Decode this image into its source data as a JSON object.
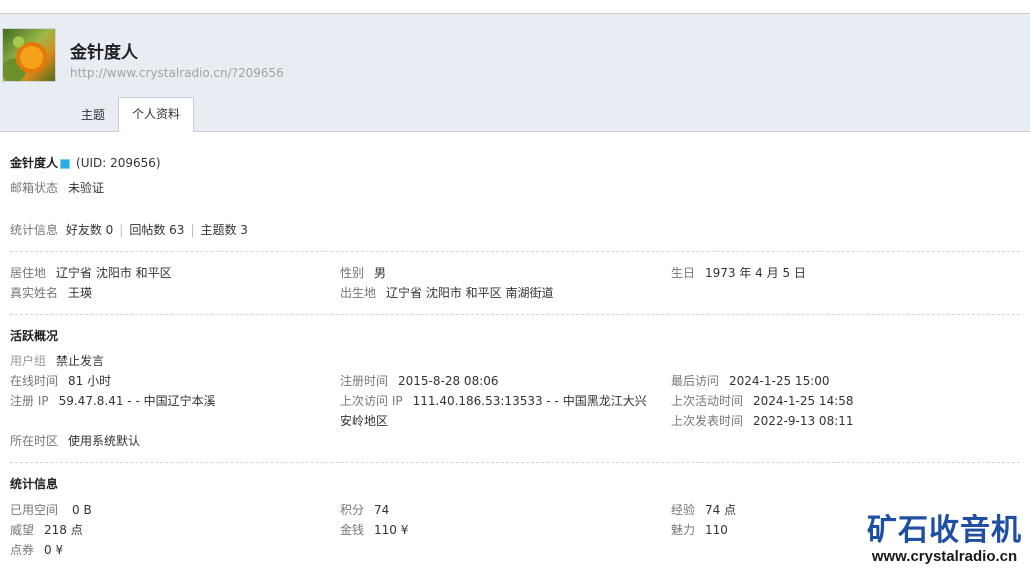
{
  "top": {
    "crumb": ""
  },
  "profile": {
    "name": "金针度人",
    "url": "http://www.crystalradio.cn/?209656",
    "tabs": [
      "主题",
      "个人资料"
    ],
    "uid": "(UID: 209656)"
  },
  "basic": {
    "email_label": "邮箱状态",
    "email_value": "未验证",
    "stats_label": "统计信息",
    "friends": "好友数 0",
    "posts": "回帖数 63",
    "threads": "主题数 3"
  },
  "personal": {
    "residence_label": "居住地",
    "residence_value": "辽宁省 沈阳市 和平区",
    "gender_label": "性别",
    "gender_value": "男",
    "birthday_label": "生日",
    "birthday_value": "1973 年 4 月 5 日",
    "realname_label": "真实姓名",
    "realname_value": "王瑛",
    "birthplace_label": "出生地",
    "birthplace_value": "辽宁省 沈阳市 和平区 南湖街道"
  },
  "activity": {
    "heading": "活跃概况",
    "group_label": "用户组",
    "group_value": "禁止发言",
    "online_label": "在线时间",
    "online_value": "81 小时",
    "reg_time_label": "注册时间",
    "reg_time_value": "2015-8-28 08:06",
    "last_visit_label": "最后访问",
    "last_visit_value": "2024-1-25 15:00",
    "reg_ip_label": "注册 IP",
    "reg_ip_value": "59.47.8.41 - - 中国辽宁本溪",
    "last_ip_label": "上次访问 IP",
    "last_ip_value": "111.40.186.53:13533 - - 中国黑龙江大兴",
    "last_ip_value_2": "安岭地区",
    "last_active_label": "上次活动时间",
    "last_active_value": "2024-1-25 14:58",
    "last_post_label": "上次发表时间",
    "last_post_value": "2022-9-13 08:11",
    "tz_label": "所在时区",
    "tz_value": "使用系统默认"
  },
  "statistics": {
    "heading": "统计信息",
    "space_label": "已用空间",
    "space_value": "0 B",
    "points_label": "积分",
    "points_value": "74",
    "exp_label": "经验",
    "exp_value": "74 点",
    "prestige_label": "威望",
    "prestige_value": "218 点",
    "money_label": "金钱",
    "money_value": "110 ¥",
    "charm_label": "魅力",
    "charm_value": "110",
    "coupon_label": "点券",
    "coupon_value": "0 ¥"
  },
  "watermark": {
    "title": "矿石收音机",
    "url": "www.crystalradio.cn"
  },
  "colors": {
    "header_bg": "#e8edf3",
    "watermark_blue": "#1f4fa3",
    "badge": "#2ab0e0"
  }
}
